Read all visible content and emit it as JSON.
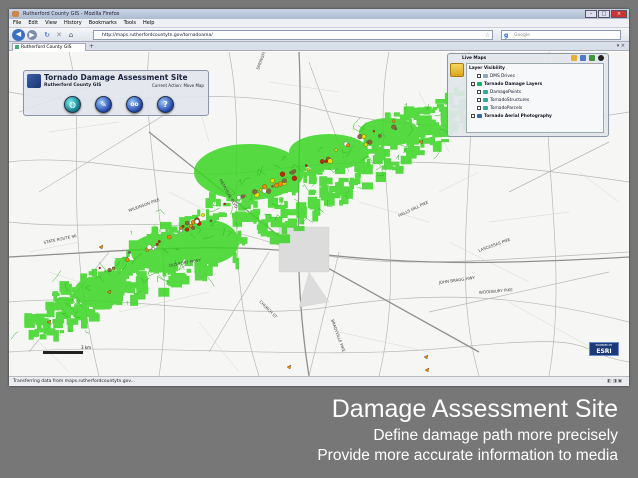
{
  "browser": {
    "window_title": "Rutherford County GIS - Mozilla Firefox",
    "menu": [
      "File",
      "Edit",
      "View",
      "History",
      "Bookmarks",
      "Tools",
      "Help"
    ],
    "url": "http://maps.rutherfordcountytn.gov/tornadoarea/",
    "search_placeholder": "Google",
    "tab_label": "Rutherford County GIS",
    "status_text": "Transferring data from maps.rutherfordcountytn.gov..."
  },
  "map_app": {
    "title": "Tornado Damage Assessment Site",
    "subtitle": "Rutherford County GIS",
    "current_action": "Current Action: Move Map",
    "tools": [
      {
        "name": "globe-tool",
        "icon": "globe-icon"
      },
      {
        "name": "measure-tool",
        "icon": "pencil-icon"
      },
      {
        "name": "identify-tool",
        "icon": "binoculars-icon",
        "glyph": "oo"
      },
      {
        "name": "help-tool",
        "icon": "question-icon",
        "glyph": "?"
      }
    ],
    "scale_label": "3 km",
    "esri_powered": "POWERED BY",
    "esri_label": "ESRI"
  },
  "live_maps": {
    "header": "Live Maps",
    "layers": [
      {
        "label": "Layer Visibility",
        "bold": true
      },
      {
        "label": "DMS Drives",
        "bold": false
      },
      {
        "label": "Tornado Damage Layers",
        "bold": true
      },
      {
        "label": "DamagePoints",
        "bold": false
      },
      {
        "label": "TornadoStructures",
        "bold": false
      },
      {
        "label": "TornadoParcels",
        "bold": false
      },
      {
        "label": "Tornado Aerial Photography",
        "bold": true
      }
    ]
  },
  "street_labels": [
    "STATE ROUTE 96",
    "WILKINSON PIKE",
    "SPRINGFIELD RD",
    "HALLS HILL PIKE",
    "JOHN BRAGG HWY",
    "WOODBURY PIKE",
    "LASCASSAS PIKE",
    "OLD FORT PKWY",
    "MEMORIAL BLVD",
    "CHURCH ST",
    "BRADYVILLE PIKE"
  ],
  "caption": {
    "title": "Damage Assessment Site",
    "line1": "Define damage path more precisely",
    "line2": "Provide more accurate information to media"
  },
  "colors": {
    "slide_bg": "#777777",
    "damage_area": "#33dd22",
    "roads": "#b0b0b0",
    "highway": "#888888",
    "marker_red": "#cc2200",
    "marker_orange": "#ee8800",
    "marker_yellow": "#eedd00"
  }
}
